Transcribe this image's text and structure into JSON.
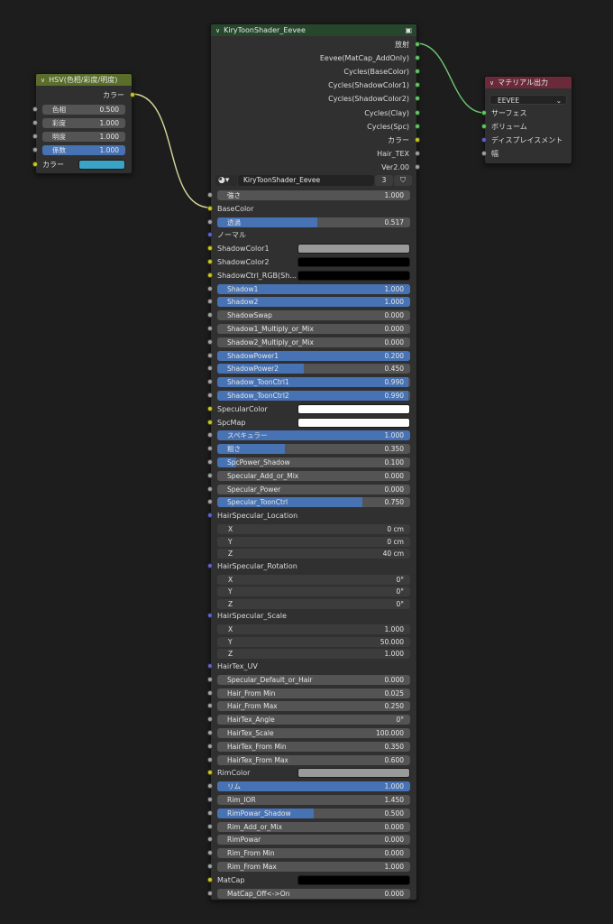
{
  "colors": {
    "hsv_header": "#5a6d2a",
    "kiry_header": "#26472c",
    "mat_header": "#6a2a39",
    "wire_yellow": "#d8d89a",
    "wire_green": "#6fc76f"
  },
  "hsv": {
    "title": "HSV(色相/彩度/明度)",
    "output": "カラー",
    "inputs": [
      {
        "label": "色相",
        "value": "0.500"
      },
      {
        "label": "彩度",
        "value": "1.000"
      },
      {
        "label": "明度",
        "value": "1.000"
      },
      {
        "label": "係数",
        "value": "1.000",
        "fill": 1.0
      }
    ],
    "color_input": "カラー",
    "color_swatch": "#3aa3c6"
  },
  "kiry": {
    "title": "KiryToonShader_Eevee",
    "header_icon": "node-group-icon",
    "outputs": [
      {
        "label": "放射",
        "socket": "green"
      },
      {
        "label": "Eevee(MatCap_AddOnly)",
        "socket": "green"
      },
      {
        "label": "Cycles(BaseColor)",
        "socket": "green"
      },
      {
        "label": "Cycles(ShadowColor1)",
        "socket": "green"
      },
      {
        "label": "Cycles(ShadowColor2)",
        "socket": "green"
      },
      {
        "label": "Cycles(Clay)",
        "socket": "green"
      },
      {
        "label": "Cycles(Spc)",
        "socket": "green"
      },
      {
        "label": "カラー",
        "socket": "yellow"
      },
      {
        "label": "Hair_TEX",
        "socket": "gray"
      },
      {
        "label": "Ver2.00",
        "socket": "gray"
      }
    ],
    "selector": {
      "name": "KiryToonShader_Eevee",
      "count": "3"
    },
    "inputs": [
      {
        "t": "f",
        "label": "強さ",
        "value": "1.000",
        "s": "gray"
      },
      {
        "t": "l",
        "label": "BaseColor",
        "s": "yellow"
      },
      {
        "t": "f",
        "label": "透過",
        "value": "0.517",
        "fill": 0.517,
        "s": "gray"
      },
      {
        "t": "l",
        "label": "ノーマル",
        "s": "purple"
      },
      {
        "t": "c",
        "label": "ShadowColor1",
        "color": "#9a9a9a",
        "s": "yellow"
      },
      {
        "t": "c",
        "label": "ShadowColor2",
        "color": "#000000",
        "s": "yellow"
      },
      {
        "t": "c",
        "label": "ShadowCtrl_RGB(Sh...",
        "color": "#000000",
        "s": "yellow"
      },
      {
        "t": "f",
        "label": "Shadow1",
        "value": "1.000",
        "fill": 1,
        "s": "gray"
      },
      {
        "t": "f",
        "label": "Shadow2",
        "value": "1.000",
        "fill": 1,
        "s": "gray"
      },
      {
        "t": "f",
        "label": "ShadowSwap",
        "value": "0.000",
        "s": "gray"
      },
      {
        "t": "f",
        "label": "Shadow1_Multiply_or_Mix",
        "value": "0.000",
        "s": "gray"
      },
      {
        "t": "f",
        "label": "Shadow2_Multiply_or_Mix",
        "value": "0.000",
        "s": "gray"
      },
      {
        "t": "f",
        "label": "ShadowPower1",
        "value": "0.200",
        "fill": 1,
        "s": "gray"
      },
      {
        "t": "f",
        "label": "ShadowPower2",
        "value": "0.450",
        "fill": 0.45,
        "s": "gray"
      },
      {
        "t": "f",
        "label": "Shadow_ToonCtrl1",
        "value": "0.990",
        "fill": 0.99,
        "s": "gray"
      },
      {
        "t": "f",
        "label": "Shadow_ToonCtrl2",
        "value": "0.990",
        "fill": 0.99,
        "s": "gray"
      },
      {
        "t": "c",
        "label": "SpecularColor",
        "color": "#ffffff",
        "s": "yellow"
      },
      {
        "t": "c",
        "label": "SpcMap",
        "color": "#ffffff",
        "s": "yellow"
      },
      {
        "t": "f",
        "label": "スペキュラー",
        "value": "1.000",
        "fill": 1,
        "s": "gray"
      },
      {
        "t": "f",
        "label": "粗さ",
        "value": "0.350",
        "fill": 0.35,
        "s": "gray"
      },
      {
        "t": "f",
        "label": "SpcPower_Shadow",
        "value": "0.100",
        "fill": 0.1,
        "s": "gray"
      },
      {
        "t": "f",
        "label": "Specular_Add_or_Mix",
        "value": "0.000",
        "s": "gray"
      },
      {
        "t": "f",
        "label": "Specular_Power",
        "value": "0.000",
        "s": "gray"
      },
      {
        "t": "f",
        "label": "Specular_ToonCtrl",
        "value": "0.750",
        "fill": 0.75,
        "s": "gray"
      },
      {
        "t": "l",
        "label": "HairSpecular_Location",
        "s": "purple"
      },
      {
        "t": "v",
        "label": "X",
        "value": "0 cm"
      },
      {
        "t": "v",
        "label": "Y",
        "value": "0 cm"
      },
      {
        "t": "v",
        "label": "Z",
        "value": "40 cm"
      },
      {
        "t": "l",
        "label": "HairSpecular_Rotation",
        "s": "purple"
      },
      {
        "t": "v",
        "label": "X",
        "value": "0°"
      },
      {
        "t": "v",
        "label": "Y",
        "value": "0°"
      },
      {
        "t": "v",
        "label": "Z",
        "value": "0°"
      },
      {
        "t": "l",
        "label": "HairSpecular_Scale",
        "s": "purple"
      },
      {
        "t": "v",
        "label": "X",
        "value": "1.000"
      },
      {
        "t": "v",
        "label": "Y",
        "value": "50.000"
      },
      {
        "t": "v",
        "label": "Z",
        "value": "1.000"
      },
      {
        "t": "l",
        "label": "HairTex_UV",
        "s": "purple"
      },
      {
        "t": "f",
        "label": "Specular_Default_or_Hair",
        "value": "0.000",
        "s": "gray"
      },
      {
        "t": "f",
        "label": "Hair_From Min",
        "value": "0.025",
        "s": "gray"
      },
      {
        "t": "f",
        "label": "Hair_From Max",
        "value": "0.250",
        "s": "gray"
      },
      {
        "t": "f",
        "label": "HairTex_Angle",
        "value": "0°",
        "s": "gray"
      },
      {
        "t": "f",
        "label": "HairTex_Scale",
        "value": "100.000",
        "s": "gray"
      },
      {
        "t": "f",
        "label": "HairTex_From Min",
        "value": "0.350",
        "s": "gray"
      },
      {
        "t": "f",
        "label": "HairTex_From Max",
        "value": "0.600",
        "s": "gray"
      },
      {
        "t": "c",
        "label": "RimColor",
        "color": "#9a9a9a",
        "s": "yellow"
      },
      {
        "t": "f",
        "label": "リム",
        "value": "1.000",
        "fill": 1,
        "s": "gray"
      },
      {
        "t": "f",
        "label": "Rim_IOR",
        "value": "1.450",
        "s": "gray"
      },
      {
        "t": "f",
        "label": "RimPowar_Shadow",
        "value": "0.500",
        "fill": 0.5,
        "s": "gray"
      },
      {
        "t": "f",
        "label": "Rim_Add_or_Mix",
        "value": "0.000",
        "s": "gray"
      },
      {
        "t": "f",
        "label": "RimPowar",
        "value": "0.000",
        "s": "gray"
      },
      {
        "t": "f",
        "label": "Rim_From Min",
        "value": "0.000",
        "s": "gray"
      },
      {
        "t": "f",
        "label": "Rim_From Max",
        "value": "1.000",
        "s": "gray"
      },
      {
        "t": "c",
        "label": "MatCap",
        "color": "#000000",
        "s": "yellow"
      },
      {
        "t": "f",
        "label": "MatCap_Off<->On",
        "value": "0.000",
        "s": "gray"
      }
    ]
  },
  "mat": {
    "title": "マテリアル出力",
    "target": "EEVEE",
    "inputs": [
      {
        "label": "サーフェス",
        "socket": "green"
      },
      {
        "label": "ボリューム",
        "socket": "green"
      },
      {
        "label": "ディスプレイスメント",
        "socket": "purple"
      },
      {
        "label": "幅",
        "socket": "gray"
      }
    ]
  }
}
